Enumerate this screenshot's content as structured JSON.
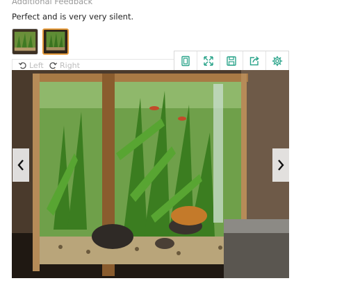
{
  "feedback": {
    "section_label": "Additional Feedback",
    "text": "Perfect and is very very silent."
  },
  "thumbnails": [
    {
      "name": "photo-1",
      "selected": false
    },
    {
      "name": "photo-2",
      "selected": true
    }
  ],
  "rotate": {
    "left_label": "Left",
    "right_label": "Right"
  },
  "toolbar": {
    "icons": [
      "fit-page-icon",
      "fullscreen-icon",
      "save-icon",
      "share-icon",
      "settings-icon"
    ]
  },
  "viewer": {
    "prev_icon": "chevron-left-icon",
    "next_icon": "chevron-right-icon",
    "image_subject": "aquarium"
  },
  "colors": {
    "accent": "#e59a3a",
    "toolbar_icon": "#2aa48a"
  }
}
